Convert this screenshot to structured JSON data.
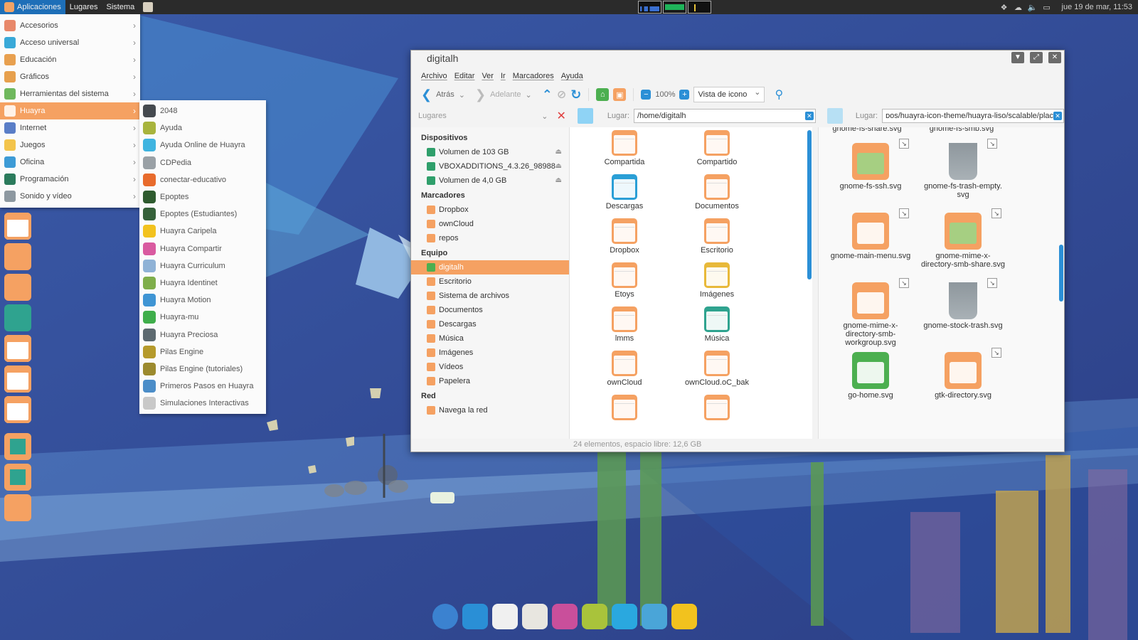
{
  "top_panel": {
    "menus": [
      "Aplicaciones",
      "Lugares",
      "Sistema"
    ],
    "clock": "jue 19 de mar, 11:53"
  },
  "apps_menu": {
    "items": [
      {
        "label": "Accesorios",
        "color": "#e8886a"
      },
      {
        "label": "Acceso universal",
        "color": "#39a9d8"
      },
      {
        "label": "Educación",
        "color": "#e8a04f"
      },
      {
        "label": "Gráficos",
        "color": "#e7a04d"
      },
      {
        "label": "Herramientas del sistema",
        "color": "#6fb85d"
      },
      {
        "label": "Huayra",
        "color": "#fff2e8"
      },
      {
        "label": "Internet",
        "color": "#5a7ec7"
      },
      {
        "label": "Juegos",
        "color": "#f3c44b"
      },
      {
        "label": "Oficina",
        "color": "#3d9bd6"
      },
      {
        "label": "Programación",
        "color": "#2b7b5c"
      },
      {
        "label": "Sonido y vídeo",
        "color": "#8d98a0"
      }
    ],
    "active_index": 5
  },
  "huayra_submenu": {
    "items": [
      {
        "label": "2048",
        "color": "#454a4f"
      },
      {
        "label": "Ayuda",
        "color": "#a8b43d"
      },
      {
        "label": "Ayuda Online de Huayra",
        "color": "#3fb4e0"
      },
      {
        "label": "CDPedia",
        "color": "#9aa1a6"
      },
      {
        "label": "conectar-educativo",
        "color": "#e86b2c"
      },
      {
        "label": "Epoptes",
        "color": "#2f5b2f"
      },
      {
        "label": "Epoptes (Estudiantes)",
        "color": "#36613a"
      },
      {
        "label": "Huayra Caripela",
        "color": "#f2c21e"
      },
      {
        "label": "Huayra Compartir",
        "color": "#d95aa0"
      },
      {
        "label": "Huayra Curriculum",
        "color": "#8fb2d6"
      },
      {
        "label": "Huayra Identinet",
        "color": "#7fae4b"
      },
      {
        "label": "Huayra Motion",
        "color": "#3f95d4"
      },
      {
        "label": "Huayra-mu",
        "color": "#3fae4b"
      },
      {
        "label": "Huayra Preciosa",
        "color": "#5d6a70"
      },
      {
        "label": "Pilas Engine",
        "color": "#b59a2b"
      },
      {
        "label": "Pilas Engine (tutoriales)",
        "color": "#9c8a2e"
      },
      {
        "label": "Primeros Pasos en Huayra",
        "color": "#4b8dc8"
      },
      {
        "label": "Simulaciones Interactivas",
        "color": "#c8c8c8"
      }
    ]
  },
  "file_manager": {
    "title": "digitalh",
    "menubar": [
      "Archivo",
      "Editar",
      "Ver",
      "Ir",
      "Marcadores",
      "Ayuda"
    ],
    "toolbar": {
      "back": "Atrás",
      "forward": "Adelante",
      "zoom": "100%",
      "view_mode": "Vista de icono"
    },
    "places_label": "Lugares",
    "location_label": "Lugar:",
    "location_a": "/home/digitalh",
    "location_b": "ᴅos/huayra-icon-theme/huayra-liso/scalable/places",
    "sidebar": [
      {
        "heading": "Dispositivos",
        "items": [
          {
            "label": "Volumen de 103 GB",
            "eject": true
          },
          {
            "label": "VBOXADDITIONS_4.3.26_98988",
            "eject": true
          },
          {
            "label": "Volumen de 4,0 GB",
            "eject": true
          }
        ]
      },
      {
        "heading": "Marcadores",
        "items": [
          {
            "label": "Dropbox"
          },
          {
            "label": "ownCloud"
          },
          {
            "label": "repos"
          }
        ]
      },
      {
        "heading": "Equipo",
        "items": [
          {
            "label": "digitalh",
            "active": true
          },
          {
            "label": "Escritorio"
          },
          {
            "label": "Sistema de archivos"
          },
          {
            "label": "Documentos"
          },
          {
            "label": "Descargas"
          },
          {
            "label": "Música"
          },
          {
            "label": "Imágenes"
          },
          {
            "label": "Vídeos"
          },
          {
            "label": "Papelera"
          }
        ]
      },
      {
        "heading": "Red",
        "items": [
          {
            "label": "Navega la red"
          }
        ]
      }
    ],
    "pane_a_files": [
      {
        "label": "Compartida",
        "kind": "folder"
      },
      {
        "label": "Compartido",
        "kind": "folder-green"
      },
      {
        "label": "Descargas",
        "kind": "download"
      },
      {
        "label": "Documentos",
        "kind": "folder"
      },
      {
        "label": "Dropbox",
        "kind": "folder"
      },
      {
        "label": "Escritorio",
        "kind": "desktop"
      },
      {
        "label": "Etoys",
        "kind": "folder"
      },
      {
        "label": "Imágenes",
        "kind": "camera"
      },
      {
        "label": "lmms",
        "kind": "folder"
      },
      {
        "label": "Música",
        "kind": "music"
      },
      {
        "label": "ownCloud",
        "kind": "folder"
      },
      {
        "label": "ownCloud.oC_bak",
        "kind": "folder"
      },
      {
        "label": "",
        "kind": "doc"
      },
      {
        "label": "",
        "kind": "folder-link"
      }
    ],
    "pane_b_top": [
      "gnome-fs-share.svg",
      "gnome-fs-smb.svg"
    ],
    "pane_b_files": [
      {
        "label": "gnome-fs-ssh.svg",
        "kind": "folder-green"
      },
      {
        "label": "gnome-fs-trash-empty. svg",
        "kind": "trash"
      },
      {
        "label": "gnome-main-menu.svg",
        "kind": "sun"
      },
      {
        "label": "gnome-mime-x- directory-smb-share.svg",
        "kind": "folder-green"
      },
      {
        "label": "gnome-mime-x- directory-smb- workgroup.svg",
        "kind": "monitor"
      },
      {
        "label": "gnome-stock-trash.svg",
        "kind": "trash"
      },
      {
        "label": "go-home.svg",
        "kind": "home"
      },
      {
        "label": "gtk-directory.svg",
        "kind": "folder"
      }
    ],
    "status": "24 elementos, espacio libre: 12,6 GB"
  },
  "left_dock_icons": [
    "folder-icon",
    "camera-icon",
    "film-icon",
    "music-icon",
    "folder-icon",
    "folder-icon",
    "folder-icon",
    "disc-icon",
    "disc-icon",
    "tag-icon"
  ],
  "bottom_dock_icons": [
    "chrome-icon",
    "terminal-icon",
    "cow-icon",
    "document-gear-icon",
    "flower-icon",
    "book-icon",
    "sun-icon",
    "cabinet-icon",
    "teapot-icon"
  ]
}
